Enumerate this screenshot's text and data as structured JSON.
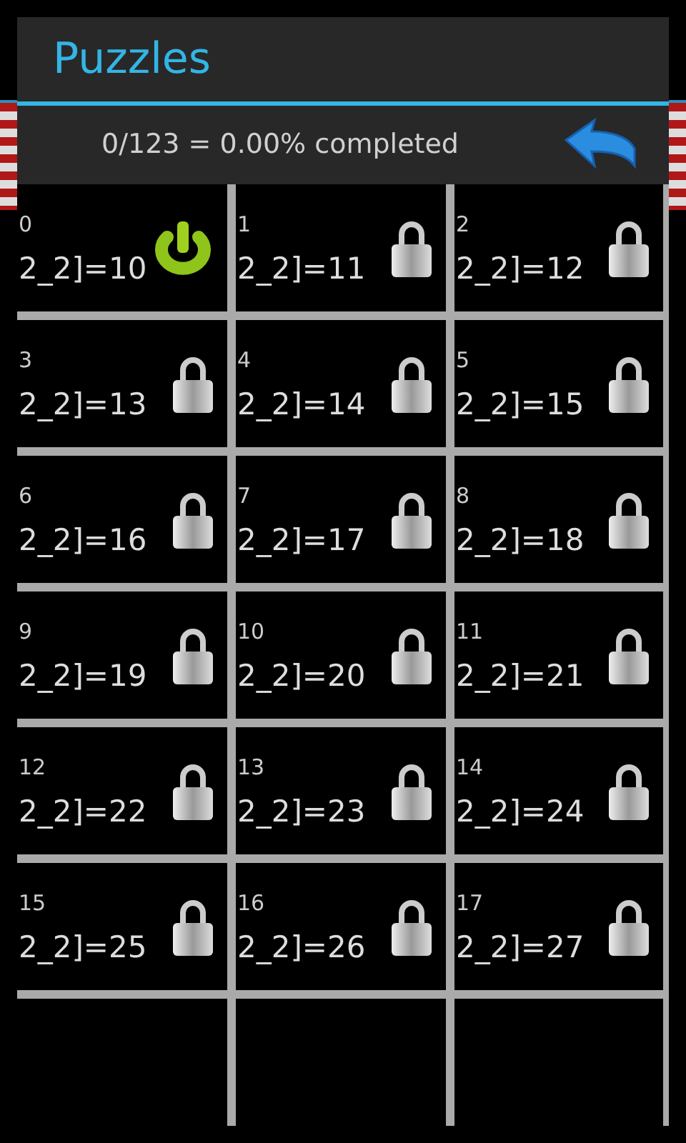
{
  "dialog": {
    "title": "Puzzles",
    "progress": "0/123 = 0.00% completed"
  },
  "puzzles": [
    {
      "number": "0",
      "label": "2_2]=10",
      "locked": false
    },
    {
      "number": "1",
      "label": "2_2]=11",
      "locked": true
    },
    {
      "number": "2",
      "label": "2_2]=12",
      "locked": true
    },
    {
      "number": "3",
      "label": "2_2]=13",
      "locked": true
    },
    {
      "number": "4",
      "label": "2_2]=14",
      "locked": true
    },
    {
      "number": "5",
      "label": "2_2]=15",
      "locked": true
    },
    {
      "number": "6",
      "label": "2_2]=16",
      "locked": true
    },
    {
      "number": "7",
      "label": "2_2]=17",
      "locked": true
    },
    {
      "number": "8",
      "label": "2_2]=18",
      "locked": true
    },
    {
      "number": "9",
      "label": "2_2]=19",
      "locked": true
    },
    {
      "number": "10",
      "label": "2_2]=20",
      "locked": true
    },
    {
      "number": "11",
      "label": "2_2]=21",
      "locked": true
    },
    {
      "number": "12",
      "label": "2_2]=22",
      "locked": true
    },
    {
      "number": "13",
      "label": "2_2]=23",
      "locked": true
    },
    {
      "number": "14",
      "label": "2_2]=24",
      "locked": true
    },
    {
      "number": "15",
      "label": "2_2]=25",
      "locked": true
    },
    {
      "number": "16",
      "label": "2_2]=26",
      "locked": true
    },
    {
      "number": "17",
      "label": "2_2]=27",
      "locked": true
    }
  ]
}
